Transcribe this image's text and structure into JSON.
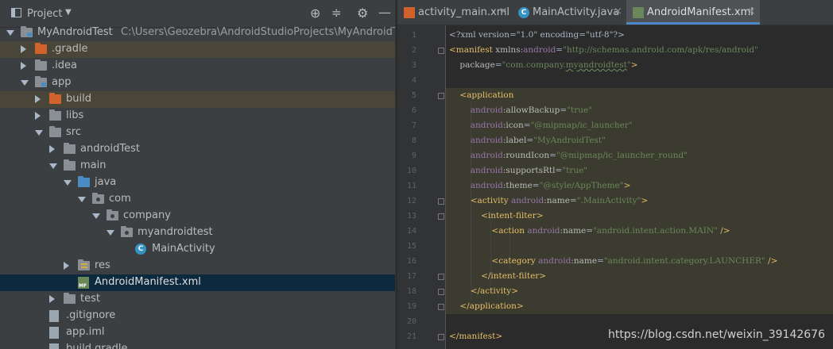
{
  "project_header": {
    "title": "Project"
  },
  "tree": [
    {
      "label": "MyAndroidTest",
      "path": "C:\\Users\\Geozebra\\AndroidStudioProjects\\MyAndroidTest",
      "arrow": "down",
      "icon": "module-folder",
      "indent": 0
    },
    {
      "label": ".gradle",
      "arrow": "right",
      "icon": "folder-orange",
      "indent": 1
    },
    {
      "label": ".idea",
      "arrow": "right",
      "icon": "folder",
      "indent": 1
    },
    {
      "label": "app",
      "arrow": "down",
      "icon": "module-folder",
      "indent": 1
    },
    {
      "label": "build",
      "arrow": "right",
      "icon": "folder-orange",
      "indent": 2
    },
    {
      "label": "libs",
      "arrow": "right",
      "icon": "folder",
      "indent": 2
    },
    {
      "label": "src",
      "arrow": "down",
      "icon": "folder",
      "indent": 2
    },
    {
      "label": "androidTest",
      "arrow": "right",
      "icon": "folder",
      "indent": 3
    },
    {
      "label": "main",
      "arrow": "down",
      "icon": "folder",
      "indent": 3
    },
    {
      "label": "java",
      "arrow": "down",
      "icon": "folder-blue",
      "indent": 4
    },
    {
      "label": "com",
      "arrow": "down",
      "icon": "package",
      "indent": 5
    },
    {
      "label": "company",
      "arrow": "down",
      "icon": "package",
      "indent": 6
    },
    {
      "label": "myandroidtest",
      "arrow": "down",
      "icon": "package",
      "indent": 7
    },
    {
      "label": "MainActivity",
      "arrow": "none",
      "icon": "class",
      "indent": 8
    },
    {
      "label": "res",
      "arrow": "right",
      "icon": "res-folder",
      "indent": 4
    },
    {
      "label": "AndroidManifest.xml",
      "arrow": "none",
      "icon": "manifest",
      "indent": 4
    },
    {
      "label": "test",
      "arrow": "right",
      "icon": "folder",
      "indent": 3
    },
    {
      "label": ".gitignore",
      "arrow": "none",
      "icon": "file",
      "indent": 2
    },
    {
      "label": "app.iml",
      "arrow": "none",
      "icon": "file",
      "indent": 2
    },
    {
      "label": "build.gradle",
      "arrow": "none",
      "icon": "file",
      "indent": 2
    }
  ],
  "tabs": [
    {
      "label": "activity_main.xml",
      "icon": "layout-xml-icon",
      "active": false
    },
    {
      "label": "MainActivity.java",
      "icon": "java-class-icon",
      "active": false
    },
    {
      "label": "AndroidManifest.xml",
      "icon": "manifest-icon",
      "active": true
    }
  ],
  "code_lines": [
    [
      [
        "plain",
        "<?xml version=\"1.0\" encoding=\"utf-8\"?>"
      ]
    ],
    [
      [
        "tag",
        "<manifest "
      ],
      [
        "attr",
        "xmlns:"
      ],
      [
        "ns",
        "android"
      ],
      [
        "plain",
        "="
      ],
      [
        "val",
        "\"http://schemas.android.com/apk/res/android\""
      ]
    ],
    [
      [
        "plain",
        "    "
      ],
      [
        "attr",
        "package"
      ],
      [
        "plain",
        "="
      ],
      [
        "val",
        "\"com.company."
      ],
      [
        "val warn",
        "myandroidtest"
      ],
      [
        "val",
        "\""
      ],
      [
        "tag",
        ">"
      ]
    ],
    [],
    [
      [
        "plain",
        "    "
      ],
      [
        "tag",
        "<application"
      ]
    ],
    [
      [
        "plain",
        "        "
      ],
      [
        "ns",
        "android"
      ],
      [
        "attr",
        ":allowBackup"
      ],
      [
        "plain",
        "="
      ],
      [
        "val",
        "\"true\""
      ]
    ],
    [
      [
        "plain",
        "        "
      ],
      [
        "ns",
        "android"
      ],
      [
        "attr",
        ":icon"
      ],
      [
        "plain",
        "="
      ],
      [
        "val",
        "\"@mipmap/ic_launcher\""
      ]
    ],
    [
      [
        "plain",
        "        "
      ],
      [
        "ns",
        "android"
      ],
      [
        "attr",
        ":label"
      ],
      [
        "plain",
        "="
      ],
      [
        "val",
        "\"MyAndroidTest\""
      ]
    ],
    [
      [
        "plain",
        "        "
      ],
      [
        "ns",
        "android"
      ],
      [
        "attr",
        ":roundIcon"
      ],
      [
        "plain",
        "="
      ],
      [
        "val",
        "\"@mipmap/ic_launcher_round\""
      ]
    ],
    [
      [
        "plain",
        "        "
      ],
      [
        "ns",
        "android"
      ],
      [
        "attr",
        ":supportsRtl"
      ],
      [
        "plain",
        "="
      ],
      [
        "val",
        "\"true\""
      ]
    ],
    [
      [
        "plain",
        "        "
      ],
      [
        "ns",
        "android"
      ],
      [
        "attr",
        ":theme"
      ],
      [
        "plain",
        "="
      ],
      [
        "val",
        "\"@style/AppTheme\""
      ],
      [
        "tag",
        ">"
      ]
    ],
    [
      [
        "plain",
        "        "
      ],
      [
        "tag",
        "<activity "
      ],
      [
        "ns",
        "android"
      ],
      [
        "attr",
        ":name"
      ],
      [
        "plain",
        "="
      ],
      [
        "val",
        "\".MainActivity\""
      ],
      [
        "tag",
        ">"
      ]
    ],
    [
      [
        "plain",
        "            "
      ],
      [
        "tag",
        "<intent-filter>"
      ]
    ],
    [
      [
        "plain",
        "                "
      ],
      [
        "tag",
        "<action "
      ],
      [
        "ns",
        "android"
      ],
      [
        "attr",
        ":name"
      ],
      [
        "plain",
        "="
      ],
      [
        "val",
        "\"android.intent.action.MAIN\""
      ],
      [
        "tag",
        " />"
      ]
    ],
    [],
    [
      [
        "plain",
        "                "
      ],
      [
        "tag",
        "<category "
      ],
      [
        "ns",
        "android"
      ],
      [
        "attr",
        ":name"
      ],
      [
        "plain",
        "="
      ],
      [
        "val",
        "\"android.intent.category.LAUNCHER\""
      ],
      [
        "tag",
        " />"
      ]
    ],
    [
      [
        "plain",
        "            "
      ],
      [
        "tag",
        "</intent-filter>"
      ]
    ],
    [
      [
        "plain",
        "        "
      ],
      [
        "tag",
        "</activity>"
      ]
    ],
    [
      [
        "plain",
        "    "
      ],
      [
        "tag",
        "</application>"
      ]
    ],
    [],
    [
      [
        "tag",
        "</manifest>"
      ]
    ]
  ],
  "watermark": "https://blog.csdn.net/weixin_39142676"
}
